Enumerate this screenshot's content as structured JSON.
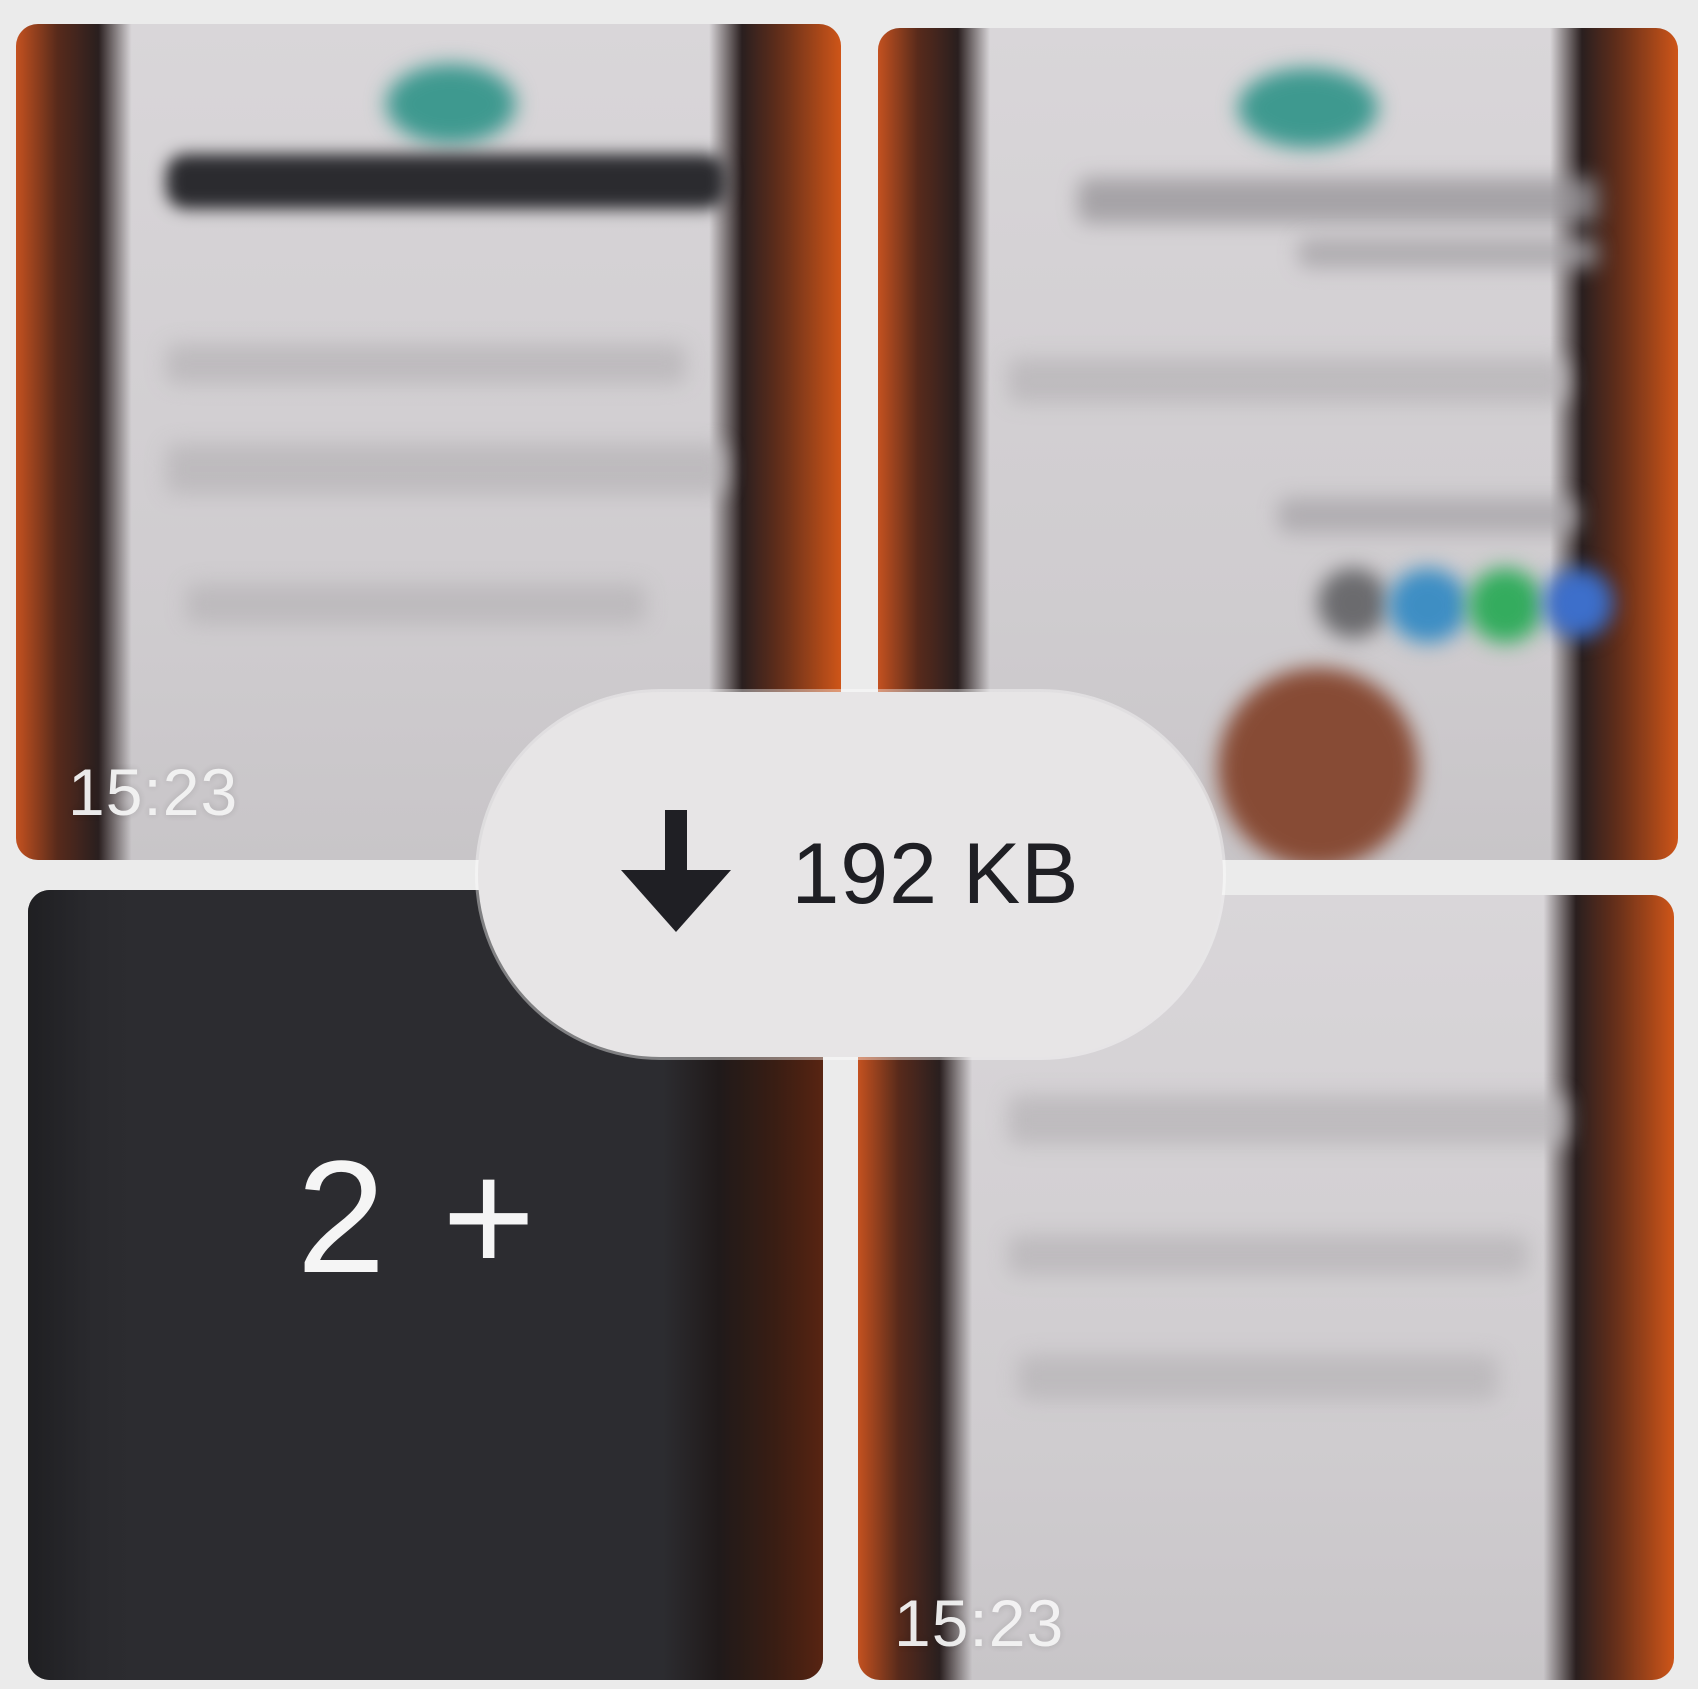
{
  "media_grid": {
    "tiles": [
      {
        "timestamp": "15:23"
      },
      {
        "timestamp": ""
      },
      {
        "more_count": "2 +"
      },
      {
        "timestamp": "15:23"
      }
    ]
  },
  "download": {
    "icon": "download-arrow-icon",
    "size_label": "192 KB"
  }
}
